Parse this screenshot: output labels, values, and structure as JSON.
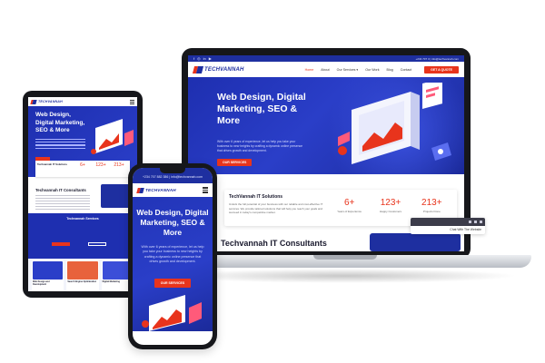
{
  "brand": {
    "name_part1": "TECHVANNAH",
    "colors": {
      "primary": "#1e2fa0",
      "accent": "#e8341c",
      "hero": "#2a3ec8"
    }
  },
  "laptop": {
    "topbar": {
      "socials": [
        "f",
        "◎",
        "in",
        "▶"
      ],
      "contact": "+234 707 3 | info@techvannah.com"
    },
    "nav": {
      "items": [
        "Home",
        "About",
        "Our Services ▾",
        "Our Work",
        "Blog",
        "Contact"
      ],
      "active_index": 0,
      "quote_button": "GET A QUOTE"
    },
    "hero": {
      "title": "Web Design, Digital Marketing, SEO & More",
      "text": "With over 6 years of experience, let us help you take your business to new heights by crafting a dynamic online presence that drives growth and development.",
      "button": "OUR SERVICES"
    },
    "stats_card": {
      "title": "TechVannah IT Solutions",
      "desc": "Unlock the full potential of your business with our reliable and cost-effective IT services. We provide tailored solutions that will help you reach your goals and succeed in today's competitive market.",
      "stats": [
        {
          "value": "6+",
          "label": "Years of Experience"
        },
        {
          "value": "123+",
          "label": "Happy Customers"
        },
        {
          "value": "213+",
          "label": "Projects Done"
        }
      ]
    },
    "consultants_title": "Techvannah IT Consultants",
    "chat_widget": {
      "label": "Chat With The Website"
    }
  },
  "tablet": {
    "hero_title": "Web Design, Digital Marketing, SEO & More",
    "stats_title": "Techvannah IT Solutions",
    "stats": [
      "6+",
      "123+",
      "213+"
    ],
    "consultants_title": "Techvannah IT Consultants",
    "services_title": "Techvannah Services",
    "cards": [
      "Web Design and Development",
      "Search Engine Optimization",
      "Digital Marketing"
    ]
  },
  "phone": {
    "topbar": "+234 707 882 386 | info@techvannah.com",
    "hero": {
      "title": "Web Design, Digital Marketing, SEO & More",
      "text": "With over 6 years of experience, let us help you take your business to new heights by crafting a dynamic online presence that drives growth and development.",
      "button": "OUR SERVICES"
    }
  },
  "icons": {
    "menu": "hamburger-menu-icon",
    "search": "search-icon",
    "chat": "chat-icon"
  }
}
